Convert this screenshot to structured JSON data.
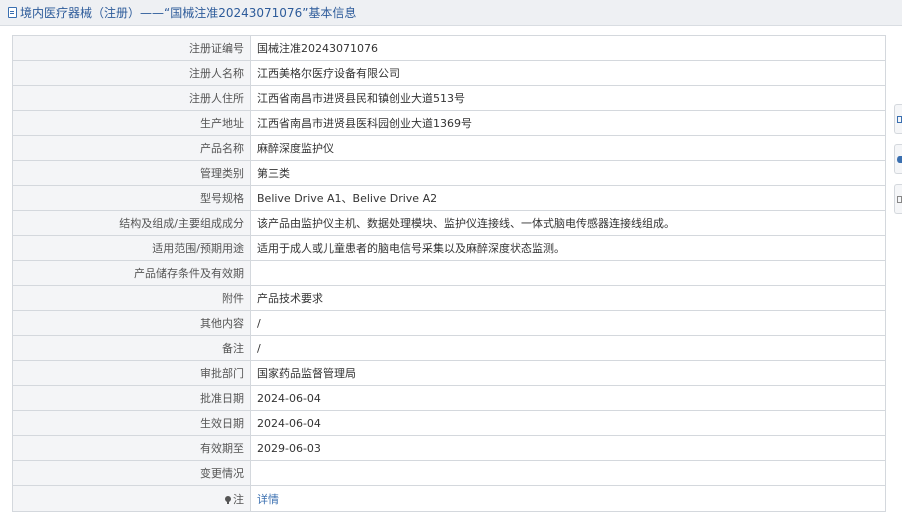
{
  "header": {
    "title": "境内医疗器械（注册）——“国械注准20243071076”基本信息"
  },
  "rows": [
    {
      "label": "注册证编号",
      "value": "国械注准20243071076"
    },
    {
      "label": "注册人名称",
      "value": "江西美格尔医疗设备有限公司"
    },
    {
      "label": "注册人住所",
      "value": "江西省南昌市进贤县民和镇创业大道513号"
    },
    {
      "label": "生产地址",
      "value": "江西省南昌市进贤县医科园创业大道1369号"
    },
    {
      "label": "产品名称",
      "value": "麻醉深度监护仪"
    },
    {
      "label": "管理类别",
      "value": "第三类"
    },
    {
      "label": "型号规格",
      "value": "Belive Drive A1、Belive Drive A2"
    },
    {
      "label": "结构及组成/主要组成成分",
      "value": "该产品由监护仪主机、数据处理模块、监护仪连接线、一体式脑电传感器连接线组成。"
    },
    {
      "label": "适用范围/预期用途",
      "value": "适用于成人或儿童患者的脑电信号采集以及麻醉深度状态监测。"
    },
    {
      "label": "产品储存条件及有效期",
      "value": ""
    },
    {
      "label": "附件",
      "value": "产品技术要求"
    },
    {
      "label": "其他内容",
      "value": "/"
    },
    {
      "label": "备注",
      "value": "/"
    },
    {
      "label": "审批部门",
      "value": "国家药品监督管理局"
    },
    {
      "label": "批准日期",
      "value": "2024-06-04"
    },
    {
      "label": "生效日期",
      "value": "2024-06-04"
    },
    {
      "label": "有效期至",
      "value": "2029-06-03"
    },
    {
      "label": "变更情况",
      "value": ""
    }
  ],
  "note_row": {
    "label": "注",
    "link_text": "详情",
    "icon": "pin-icon"
  },
  "colors": {
    "header_bg": "#eef0f3",
    "title_text": "#2d5b9a",
    "link": "#3a6fb0",
    "label_bg": "#f4f5f7",
    "border": "#d4d8dd"
  }
}
